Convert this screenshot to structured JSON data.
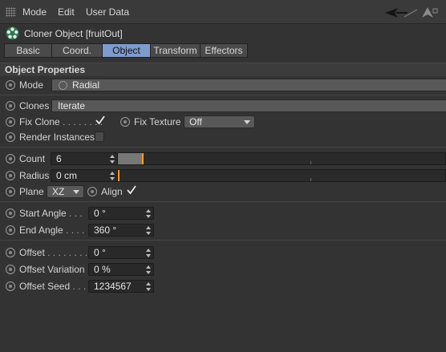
{
  "menubar": {
    "items": [
      "Mode",
      "Edit",
      "User Data"
    ]
  },
  "object": {
    "title": "Cloner Object [fruitOut]",
    "icon": "cloner-icon"
  },
  "tabs": [
    {
      "label": "Basic",
      "active": false
    },
    {
      "label": "Coord.",
      "active": false
    },
    {
      "label": "Object",
      "active": true
    },
    {
      "label": "Transform",
      "active": false
    },
    {
      "label": "Effectors",
      "active": false
    }
  ],
  "section": {
    "title": "Object Properties"
  },
  "fields": {
    "mode": {
      "label": "Mode",
      "value": "Radial",
      "icon": "radial-icon"
    },
    "clones": {
      "label": "Clones",
      "value": "Iterate"
    },
    "fix_clone": {
      "label": "Fix Clone",
      "dots": " . . . . . . . .",
      "checked": true
    },
    "fix_texture": {
      "label": "Fix Texture",
      "value": "Off"
    },
    "render_instances": {
      "label": "Render Instances",
      "checked": false
    },
    "count": {
      "label": "Count",
      "value": "6",
      "level": 0.075
    },
    "radius": {
      "label": "Radius",
      "value": "0 cm",
      "level": 0.0
    },
    "plane": {
      "label": "Plane",
      "value": "XZ"
    },
    "align": {
      "label": "Align",
      "checked": true
    },
    "start_angle": {
      "label": "Start Angle",
      "dots": " . . .",
      "value": "0 °"
    },
    "end_angle": {
      "label": "End Angle",
      "dots": " . . . .",
      "value": "360 °"
    },
    "offset": {
      "label": "Offset",
      "dots": " . . . . . . . .",
      "value": "0 °"
    },
    "offset_variation": {
      "label": "Offset Variation",
      "value": "0 %"
    },
    "offset_seed": {
      "label": "Offset Seed",
      "dots": " . . .",
      "value": "1234567"
    }
  },
  "colors": {
    "background": "#333333",
    "active_tab": "#7f9bcd",
    "slider_handle": "#f39c23"
  }
}
